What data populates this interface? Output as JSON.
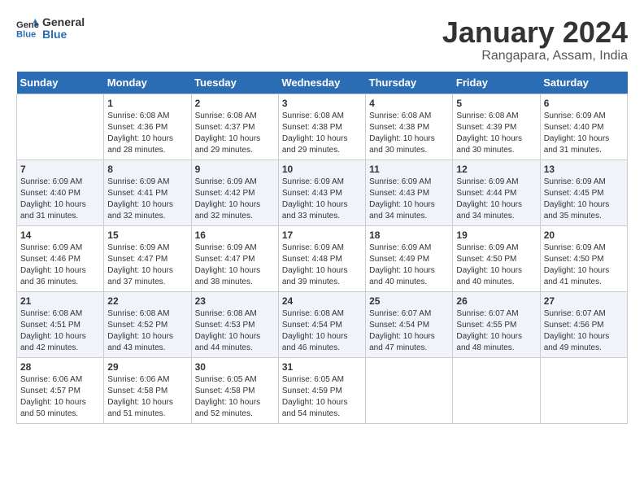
{
  "header": {
    "logo_line1": "General",
    "logo_line2": "Blue",
    "month_title": "January 2024",
    "location": "Rangapara, Assam, India"
  },
  "days_of_week": [
    "Sunday",
    "Monday",
    "Tuesday",
    "Wednesday",
    "Thursday",
    "Friday",
    "Saturday"
  ],
  "weeks": [
    [
      {
        "day": "",
        "info": ""
      },
      {
        "day": "1",
        "info": "Sunrise: 6:08 AM\nSunset: 4:36 PM\nDaylight: 10 hours\nand 28 minutes."
      },
      {
        "day": "2",
        "info": "Sunrise: 6:08 AM\nSunset: 4:37 PM\nDaylight: 10 hours\nand 29 minutes."
      },
      {
        "day": "3",
        "info": "Sunrise: 6:08 AM\nSunset: 4:38 PM\nDaylight: 10 hours\nand 29 minutes."
      },
      {
        "day": "4",
        "info": "Sunrise: 6:08 AM\nSunset: 4:38 PM\nDaylight: 10 hours\nand 30 minutes."
      },
      {
        "day": "5",
        "info": "Sunrise: 6:08 AM\nSunset: 4:39 PM\nDaylight: 10 hours\nand 30 minutes."
      },
      {
        "day": "6",
        "info": "Sunrise: 6:09 AM\nSunset: 4:40 PM\nDaylight: 10 hours\nand 31 minutes."
      }
    ],
    [
      {
        "day": "7",
        "info": "Sunrise: 6:09 AM\nSunset: 4:40 PM\nDaylight: 10 hours\nand 31 minutes."
      },
      {
        "day": "8",
        "info": "Sunrise: 6:09 AM\nSunset: 4:41 PM\nDaylight: 10 hours\nand 32 minutes."
      },
      {
        "day": "9",
        "info": "Sunrise: 6:09 AM\nSunset: 4:42 PM\nDaylight: 10 hours\nand 32 minutes."
      },
      {
        "day": "10",
        "info": "Sunrise: 6:09 AM\nSunset: 4:43 PM\nDaylight: 10 hours\nand 33 minutes."
      },
      {
        "day": "11",
        "info": "Sunrise: 6:09 AM\nSunset: 4:43 PM\nDaylight: 10 hours\nand 34 minutes."
      },
      {
        "day": "12",
        "info": "Sunrise: 6:09 AM\nSunset: 4:44 PM\nDaylight: 10 hours\nand 34 minutes."
      },
      {
        "day": "13",
        "info": "Sunrise: 6:09 AM\nSunset: 4:45 PM\nDaylight: 10 hours\nand 35 minutes."
      }
    ],
    [
      {
        "day": "14",
        "info": "Sunrise: 6:09 AM\nSunset: 4:46 PM\nDaylight: 10 hours\nand 36 minutes."
      },
      {
        "day": "15",
        "info": "Sunrise: 6:09 AM\nSunset: 4:47 PM\nDaylight: 10 hours\nand 37 minutes."
      },
      {
        "day": "16",
        "info": "Sunrise: 6:09 AM\nSunset: 4:47 PM\nDaylight: 10 hours\nand 38 minutes."
      },
      {
        "day": "17",
        "info": "Sunrise: 6:09 AM\nSunset: 4:48 PM\nDaylight: 10 hours\nand 39 minutes."
      },
      {
        "day": "18",
        "info": "Sunrise: 6:09 AM\nSunset: 4:49 PM\nDaylight: 10 hours\nand 40 minutes."
      },
      {
        "day": "19",
        "info": "Sunrise: 6:09 AM\nSunset: 4:50 PM\nDaylight: 10 hours\nand 40 minutes."
      },
      {
        "day": "20",
        "info": "Sunrise: 6:09 AM\nSunset: 4:50 PM\nDaylight: 10 hours\nand 41 minutes."
      }
    ],
    [
      {
        "day": "21",
        "info": "Sunrise: 6:08 AM\nSunset: 4:51 PM\nDaylight: 10 hours\nand 42 minutes."
      },
      {
        "day": "22",
        "info": "Sunrise: 6:08 AM\nSunset: 4:52 PM\nDaylight: 10 hours\nand 43 minutes."
      },
      {
        "day": "23",
        "info": "Sunrise: 6:08 AM\nSunset: 4:53 PM\nDaylight: 10 hours\nand 44 minutes."
      },
      {
        "day": "24",
        "info": "Sunrise: 6:08 AM\nSunset: 4:54 PM\nDaylight: 10 hours\nand 46 minutes."
      },
      {
        "day": "25",
        "info": "Sunrise: 6:07 AM\nSunset: 4:54 PM\nDaylight: 10 hours\nand 47 minutes."
      },
      {
        "day": "26",
        "info": "Sunrise: 6:07 AM\nSunset: 4:55 PM\nDaylight: 10 hours\nand 48 minutes."
      },
      {
        "day": "27",
        "info": "Sunrise: 6:07 AM\nSunset: 4:56 PM\nDaylight: 10 hours\nand 49 minutes."
      }
    ],
    [
      {
        "day": "28",
        "info": "Sunrise: 6:06 AM\nSunset: 4:57 PM\nDaylight: 10 hours\nand 50 minutes."
      },
      {
        "day": "29",
        "info": "Sunrise: 6:06 AM\nSunset: 4:58 PM\nDaylight: 10 hours\nand 51 minutes."
      },
      {
        "day": "30",
        "info": "Sunrise: 6:05 AM\nSunset: 4:58 PM\nDaylight: 10 hours\nand 52 minutes."
      },
      {
        "day": "31",
        "info": "Sunrise: 6:05 AM\nSunset: 4:59 PM\nDaylight: 10 hours\nand 54 minutes."
      },
      {
        "day": "",
        "info": ""
      },
      {
        "day": "",
        "info": ""
      },
      {
        "day": "",
        "info": ""
      }
    ]
  ]
}
